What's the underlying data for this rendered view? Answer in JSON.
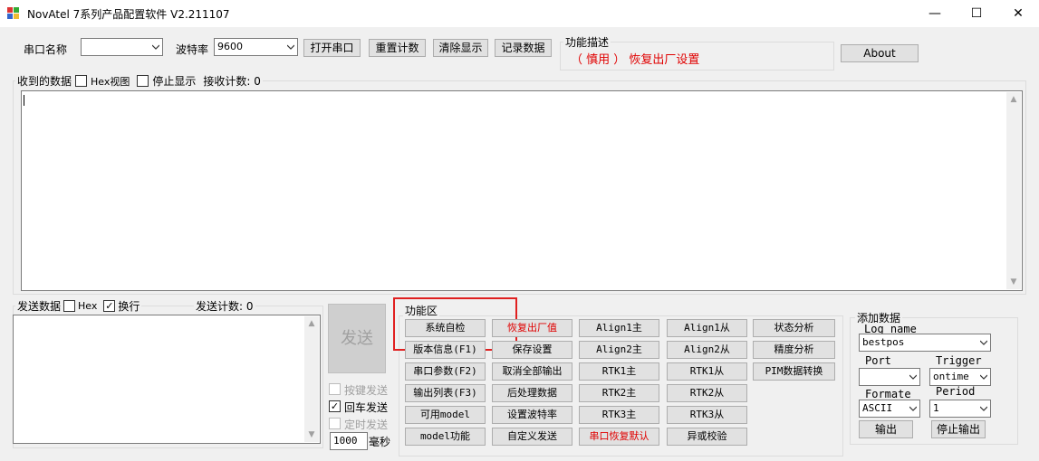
{
  "window": {
    "title": "NovAtel 7系列产品配置软件 V2.211107",
    "minimize": "—",
    "maximize": "☐",
    "close": "✕"
  },
  "toolbar": {
    "port_label": "串口名称",
    "port_value": "",
    "baud_label": "波特率",
    "baud_value": "9600",
    "open_port": "打开串口",
    "reset_count": "重置计数",
    "clear_display": "清除显示",
    "record_data": "记录数据",
    "about": "About"
  },
  "function_desc": {
    "title": "功能描述",
    "text": "（ 慎用 ） 恢复出厂设置"
  },
  "receive": {
    "title": "收到的数据",
    "hex_view": "Hex视图",
    "hex_view_checked": false,
    "stop_display": "停止显示",
    "stop_display_checked": false,
    "count_label": "接收计数: 0"
  },
  "send": {
    "title": "发送数据",
    "hex": "Hex",
    "hex_checked": false,
    "newline": "换行",
    "newline_checked": true,
    "count_label": "发送计数: 0",
    "send_button": "发送",
    "key_send": "按键发送",
    "enter_send": "回车发送",
    "enter_send_checked": true,
    "timed_send": "定时发送",
    "interval_value": "1000",
    "interval_unit": "毫秒"
  },
  "functions": {
    "title": "功能区",
    "buttons": [
      [
        "系统自检",
        "恢复出厂值",
        "Align1主",
        "Align1从",
        "状态分析"
      ],
      [
        "版本信息(F1)",
        "保存设置",
        "Align2主",
        "Align2从",
        "精度分析"
      ],
      [
        "串口参数(F2)",
        "取消全部输出",
        "RTK1主",
        "RTK1从",
        "PIM数据转换"
      ],
      [
        "输出列表(F3)",
        "后处理数据",
        "RTK2主",
        "RTK2从",
        ""
      ],
      [
        "可用model",
        "设置波特率",
        "RTK3主",
        "RTK3从",
        ""
      ],
      [
        "model功能",
        "自定义发送",
        "串口恢复默认",
        "异或校验",
        ""
      ]
    ],
    "red_color": "#e00000"
  },
  "add_data": {
    "title": "添加数据",
    "log_name_label": "Log name",
    "log_name_value": "bestpos",
    "port_label": "Port",
    "port_value": "",
    "trigger_label": "Trigger",
    "trigger_value": "ontime",
    "format_label": "Formate",
    "format_value": "ASCII",
    "period_label": "Period",
    "period_value": "1",
    "output": "输出",
    "stop_output": "停止输出"
  }
}
